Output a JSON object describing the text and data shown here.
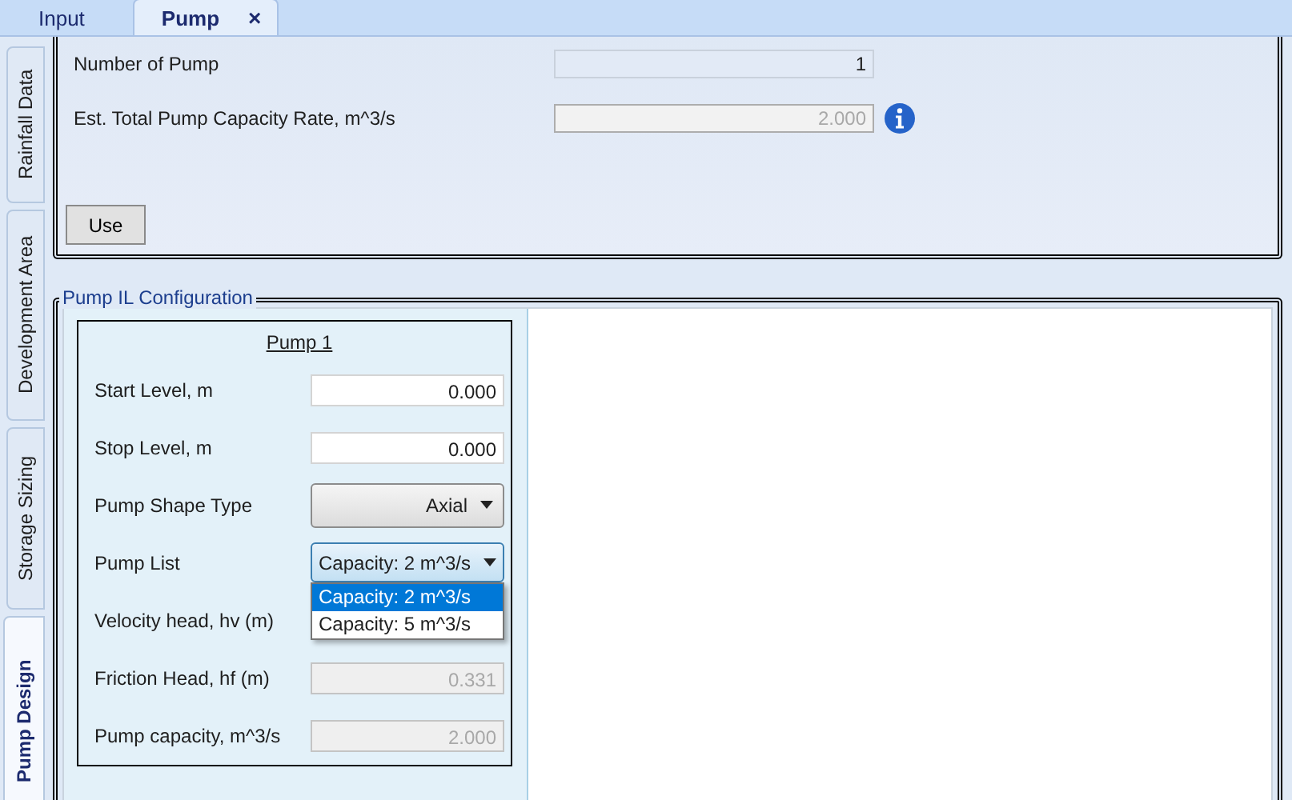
{
  "tabs": [
    {
      "label": "Input",
      "selected": false
    },
    {
      "label": "Pump",
      "selected": true,
      "close": "×"
    }
  ],
  "side_tabs": [
    {
      "label": "Rainfall Data",
      "selected": false
    },
    {
      "label": "Development Area",
      "selected": false
    },
    {
      "label": "Storage Sizing",
      "selected": false
    },
    {
      "label": "Pump Design",
      "selected": true
    }
  ],
  "summary": {
    "fields": [
      {
        "label": "Number of Pump",
        "kind": "readonly",
        "value": "1",
        "info": false
      },
      {
        "label": "Est. Total Pump Capacity Rate, m^3/s",
        "kind": "disabled",
        "value": "2.000",
        "info": true
      }
    ],
    "button": "Use"
  },
  "config": {
    "title": "Pump IL Configuration",
    "card_title": "Pump 1",
    "rows": [
      {
        "label": "Start Level, m",
        "kind": "input",
        "value": "0.000"
      },
      {
        "label": "Stop Level, m",
        "kind": "input",
        "value": "0.000"
      },
      {
        "label": "Pump Shape Type",
        "kind": "select",
        "value": "Axial",
        "open": false
      },
      {
        "label": "Pump List",
        "kind": "select",
        "value": "Capacity: 2 m^3/s",
        "open": true,
        "options": [
          {
            "label": "Capacity: 2 m^3/s",
            "selected": true
          },
          {
            "label": "Capacity: 5 m^3/s",
            "selected": false
          }
        ]
      },
      {
        "label": "Velocity head, hv (m)",
        "kind": "label"
      },
      {
        "label": "Friction Head, hf (m)",
        "kind": "disabled",
        "value": "0.331"
      },
      {
        "label": "Pump capacity, m^3/s",
        "kind": "disabled",
        "value": "2.000"
      }
    ]
  }
}
